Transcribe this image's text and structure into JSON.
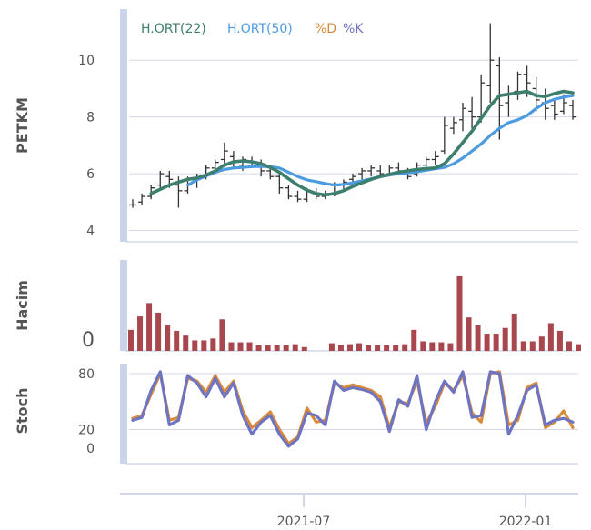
{
  "colors": {
    "ma22": "#3d7f6e",
    "ma50": "#4c9be0",
    "d": "#d98a3d",
    "k": "#6f74c0",
    "volume": "#a8474e",
    "price": "#333333",
    "side_bar": "#c9d4ea",
    "grid": "#d4d7e8"
  },
  "chart_data": [
    {
      "type": "ohlc",
      "ylabel": "PETKM",
      "yticks": [
        "4",
        "6",
        "8",
        "10"
      ],
      "ylim": [
        3.6,
        11.8
      ],
      "legend": [
        "H.ORT(22)",
        "H.ORT(50)",
        "%D",
        "%K"
      ],
      "x_dates": [
        "2021-03-05",
        "2021-03-12",
        "2021-03-19",
        "2021-03-26",
        "2021-04-02",
        "2021-04-09",
        "2021-04-16",
        "2021-04-23",
        "2021-04-30",
        "2021-05-07",
        "2021-05-14",
        "2021-05-21",
        "2021-05-28",
        "2021-06-04",
        "2021-06-11",
        "2021-06-18",
        "2021-06-25",
        "2021-07-02",
        "2021-07-09",
        "2021-07-16",
        "2021-07-23",
        "2021-07-30",
        "2021-08-06",
        "2021-08-13",
        "2021-08-20",
        "2021-08-27",
        "2021-09-03",
        "2021-09-10",
        "2021-09-17",
        "2021-09-24",
        "2021-10-01",
        "2021-10-08",
        "2021-10-15",
        "2021-10-22",
        "2021-10-29",
        "2021-11-05",
        "2021-11-12",
        "2021-11-19",
        "2021-11-26",
        "2021-12-03",
        "2021-12-10",
        "2021-12-17",
        "2021-12-24",
        "2021-12-31",
        "2022-01-07",
        "2022-01-14",
        "2022-01-21",
        "2022-01-28",
        "2022-02-04"
      ],
      "ohlc": [
        [
          4.9,
          5.1,
          4.8,
          4.9
        ],
        [
          5.0,
          5.3,
          4.9,
          5.2
        ],
        [
          5.2,
          5.6,
          5.1,
          5.5
        ],
        [
          5.6,
          6.1,
          5.5,
          6.0
        ],
        [
          5.9,
          6.1,
          5.5,
          5.8
        ],
        [
          5.6,
          5.9,
          4.8,
          5.4
        ],
        [
          5.4,
          5.9,
          5.3,
          5.8
        ],
        [
          5.8,
          6.0,
          5.5,
          5.9
        ],
        [
          5.9,
          6.3,
          5.8,
          6.2
        ],
        [
          6.2,
          6.5,
          6.0,
          6.4
        ],
        [
          6.5,
          7.1,
          6.3,
          6.8
        ],
        [
          6.6,
          6.8,
          6.2,
          6.4
        ],
        [
          6.3,
          6.6,
          6.1,
          6.5
        ],
        [
          6.4,
          6.6,
          6.2,
          6.4
        ],
        [
          6.3,
          6.5,
          5.9,
          6.1
        ],
        [
          6.1,
          6.3,
          5.8,
          5.9
        ],
        [
          5.9,
          6.0,
          5.3,
          5.5
        ],
        [
          5.5,
          5.6,
          5.1,
          5.2
        ],
        [
          5.2,
          5.4,
          5.0,
          5.1
        ],
        [
          5.1,
          5.5,
          5.0,
          5.4
        ],
        [
          5.3,
          5.5,
          5.1,
          5.2
        ],
        [
          5.2,
          5.4,
          5.1,
          5.3
        ],
        [
          5.3,
          5.7,
          5.2,
          5.6
        ],
        [
          5.6,
          5.8,
          5.4,
          5.7
        ],
        [
          5.8,
          6.0,
          5.6,
          5.9
        ],
        [
          6.0,
          6.2,
          5.8,
          6.1
        ],
        [
          6.1,
          6.3,
          5.9,
          6.2
        ],
        [
          6.1,
          6.3,
          5.9,
          6.0
        ],
        [
          6.0,
          6.3,
          5.9,
          6.2
        ],
        [
          6.2,
          6.4,
          6.0,
          6.1
        ],
        [
          6.0,
          6.2,
          5.8,
          5.9
        ],
        [
          6.0,
          6.4,
          5.9,
          6.3
        ],
        [
          6.3,
          6.6,
          6.1,
          6.5
        ],
        [
          6.5,
          6.8,
          6.3,
          6.6
        ],
        [
          6.8,
          8.0,
          6.7,
          7.7
        ],
        [
          7.6,
          8.0,
          7.4,
          7.8
        ],
        [
          7.9,
          8.5,
          7.5,
          8.3
        ],
        [
          8.2,
          8.7,
          7.6,
          8.0
        ],
        [
          8.0,
          9.5,
          7.8,
          9.2
        ],
        [
          9.1,
          11.3,
          8.5,
          10.0
        ],
        [
          9.8,
          10.1,
          7.2,
          8.4
        ],
        [
          8.5,
          9.1,
          8.0,
          8.8
        ],
        [
          8.9,
          9.6,
          8.6,
          9.5
        ],
        [
          9.5,
          9.8,
          8.7,
          9.2
        ],
        [
          9.0,
          9.4,
          8.2,
          8.6
        ],
        [
          8.5,
          9.0,
          7.9,
          8.3
        ],
        [
          8.4,
          8.6,
          7.9,
          8.1
        ],
        [
          8.2,
          8.8,
          8.1,
          8.5
        ],
        [
          8.4,
          8.6,
          7.9,
          8.0
        ]
      ],
      "ma22": [
        null,
        null,
        5.3,
        5.45,
        5.6,
        5.7,
        5.8,
        5.85,
        5.95,
        6.1,
        6.3,
        6.42,
        6.45,
        6.42,
        6.35,
        6.22,
        6.05,
        5.82,
        5.6,
        5.42,
        5.3,
        5.25,
        5.3,
        5.4,
        5.55,
        5.68,
        5.8,
        5.9,
        5.98,
        6.05,
        6.1,
        6.15,
        6.18,
        6.2,
        6.35,
        6.7,
        7.1,
        7.5,
        7.95,
        8.4,
        8.75,
        8.8,
        8.85,
        8.9,
        8.75,
        8.72,
        8.82,
        8.9,
        8.85
      ],
      "ma50": [
        null,
        null,
        null,
        null,
        null,
        null,
        5.6,
        5.78,
        5.92,
        6.05,
        6.15,
        6.2,
        6.22,
        6.25,
        6.26,
        6.25,
        6.2,
        6.05,
        5.9,
        5.78,
        5.72,
        5.65,
        5.6,
        5.62,
        5.68,
        5.75,
        5.82,
        5.9,
        5.95,
        6.0,
        6.03,
        6.07,
        6.12,
        6.18,
        6.22,
        6.35,
        6.55,
        6.8,
        7.05,
        7.35,
        7.6,
        7.8,
        7.9,
        8.05,
        8.3,
        8.5,
        8.62,
        8.7,
        8.75
      ]
    },
    {
      "type": "bar",
      "ylabel": "Hacim",
      "yticks": [
        "0"
      ],
      "values": [
        22,
        36,
        50,
        40,
        27,
        21,
        16,
        11,
        11,
        13,
        33,
        9,
        9,
        9,
        6,
        6,
        6,
        6,
        7,
        4,
        0,
        0,
        8,
        6,
        7,
        8,
        6,
        6,
        6,
        6,
        7,
        22,
        10,
        9,
        9,
        8,
        78,
        35,
        27,
        18,
        18,
        24,
        39,
        10,
        10,
        15,
        29,
        21,
        10,
        7
      ]
    },
    {
      "type": "line",
      "ylabel": "Stoch",
      "yticks": [
        "0",
        "20",
        "80"
      ],
      "series": [
        {
          "name": "%D",
          "values": [
            32,
            35,
            58,
            80,
            30,
            33,
            75,
            72,
            60,
            78,
            60,
            72,
            40,
            22,
            30,
            39,
            20,
            5,
            12,
            43,
            28,
            30,
            70,
            65,
            68,
            65,
            62,
            55,
            22,
            50,
            48,
            72,
            27,
            45,
            70,
            62,
            78,
            38,
            28,
            80,
            82,
            25,
            30,
            65,
            70,
            22,
            28,
            40,
            22
          ]
        },
        {
          "name": "%K",
          "values": [
            30,
            33,
            62,
            82,
            25,
            30,
            78,
            70,
            55,
            75,
            55,
            70,
            35,
            15,
            28,
            35,
            15,
            2,
            10,
            38,
            35,
            25,
            72,
            62,
            65,
            63,
            60,
            50,
            18,
            52,
            45,
            78,
            20,
            50,
            72,
            60,
            82,
            33,
            35,
            82,
            80,
            15,
            35,
            62,
            68,
            25,
            30,
            32,
            28
          ]
        }
      ]
    }
  ],
  "x_axis": {
    "ticks": [
      "2021‑07",
      "2022‑01"
    ]
  }
}
